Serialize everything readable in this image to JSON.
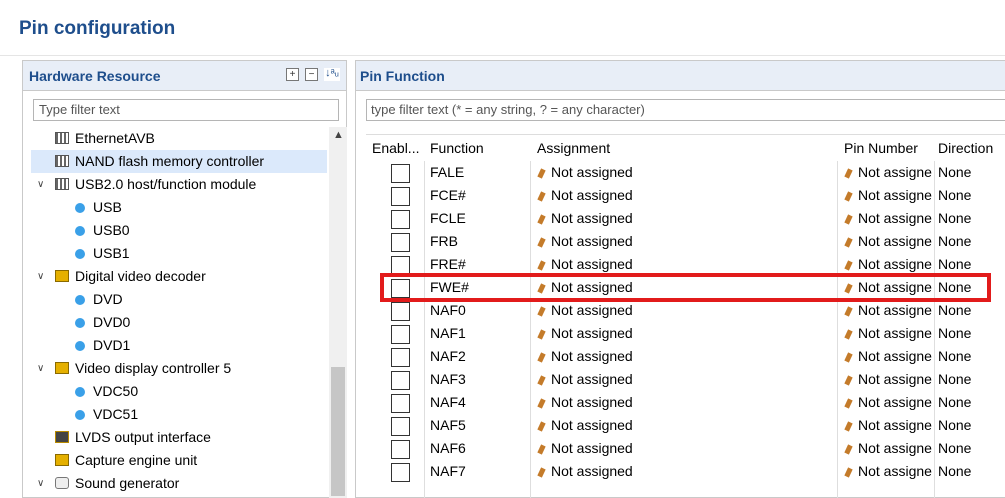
{
  "window": {
    "title": "Pin configuration"
  },
  "hardware_panel": {
    "title": "Hardware Resource",
    "filter_placeholder": "Type filter text",
    "tree": [
      {
        "label": "EthernetAVB",
        "level": 1,
        "icon": "peripheral-icon",
        "chevron": ""
      },
      {
        "label": "NAND flash memory controller",
        "level": 1,
        "icon": "peripheral-icon",
        "chevron": "",
        "selected": true
      },
      {
        "label": "USB2.0 host/function module",
        "level": 0,
        "icon": "peripheral-icon",
        "chevron": "v"
      },
      {
        "label": "USB",
        "level": 2,
        "icon": "channel-icon",
        "chevron": ""
      },
      {
        "label": "USB0",
        "level": 2,
        "icon": "channel-icon",
        "chevron": ""
      },
      {
        "label": "USB1",
        "level": 2,
        "icon": "channel-icon",
        "chevron": ""
      },
      {
        "label": "Digital video decoder",
        "level": 0,
        "icon": "video-icon",
        "chevron": "v"
      },
      {
        "label": "DVD",
        "level": 2,
        "icon": "channel-icon",
        "chevron": ""
      },
      {
        "label": "DVD0",
        "level": 2,
        "icon": "channel-icon",
        "chevron": ""
      },
      {
        "label": "DVD1",
        "level": 2,
        "icon": "channel-icon",
        "chevron": ""
      },
      {
        "label": "Video display controller 5",
        "level": 0,
        "icon": "video-icon",
        "chevron": "v"
      },
      {
        "label": "VDC50",
        "level": 2,
        "icon": "channel-icon",
        "chevron": ""
      },
      {
        "label": "VDC51",
        "level": 2,
        "icon": "channel-icon",
        "chevron": ""
      },
      {
        "label": "LVDS output interface",
        "level": 1,
        "icon": "lvds-icon",
        "chevron": ""
      },
      {
        "label": "Capture engine unit",
        "level": 1,
        "icon": "video-icon",
        "chevron": ""
      },
      {
        "label": "Sound generator",
        "level": 0,
        "icon": "sound-icon",
        "chevron": "v"
      }
    ]
  },
  "pin_panel": {
    "title": "Pin Function",
    "filter_placeholder": "type filter text (* = any string, ? = any character)",
    "columns": [
      "Enabl...",
      "Function",
      "Assignment",
      "Pin Number",
      "Direction"
    ],
    "rows": [
      {
        "function": "FALE",
        "assignment": "Not assigned",
        "pin_number": "Not assigne",
        "direction": "None"
      },
      {
        "function": "FCE#",
        "assignment": "Not assigned",
        "pin_number": "Not assigne",
        "direction": "None"
      },
      {
        "function": "FCLE",
        "assignment": "Not assigned",
        "pin_number": "Not assigne",
        "direction": "None"
      },
      {
        "function": "FRB",
        "assignment": "Not assigned",
        "pin_number": "Not assigne",
        "direction": "None"
      },
      {
        "function": "FRE#",
        "assignment": "Not assigned",
        "pin_number": "Not assigne",
        "direction": "None"
      },
      {
        "function": "FWE#",
        "assignment": "Not assigned",
        "pin_number": "Not assigne",
        "direction": "None",
        "highlighted": true
      },
      {
        "function": "NAF0",
        "assignment": "Not assigned",
        "pin_number": "Not assigne",
        "direction": "None"
      },
      {
        "function": "NAF1",
        "assignment": "Not assigned",
        "pin_number": "Not assigne",
        "direction": "None"
      },
      {
        "function": "NAF2",
        "assignment": "Not assigned",
        "pin_number": "Not assigne",
        "direction": "None"
      },
      {
        "function": "NAF3",
        "assignment": "Not assigned",
        "pin_number": "Not assigne",
        "direction": "None"
      },
      {
        "function": "NAF4",
        "assignment": "Not assigned",
        "pin_number": "Not assigne",
        "direction": "None"
      },
      {
        "function": "NAF5",
        "assignment": "Not assigned",
        "pin_number": "Not assigne",
        "direction": "None"
      },
      {
        "function": "NAF6",
        "assignment": "Not assigned",
        "pin_number": "Not assigne",
        "direction": "None"
      },
      {
        "function": "NAF7",
        "assignment": "Not assigned",
        "pin_number": "Not assigne",
        "direction": "None"
      }
    ]
  },
  "colors": {
    "title": "#1e4e8c",
    "highlight": "#e21b1b",
    "selected_row": "#dbe9fb"
  }
}
